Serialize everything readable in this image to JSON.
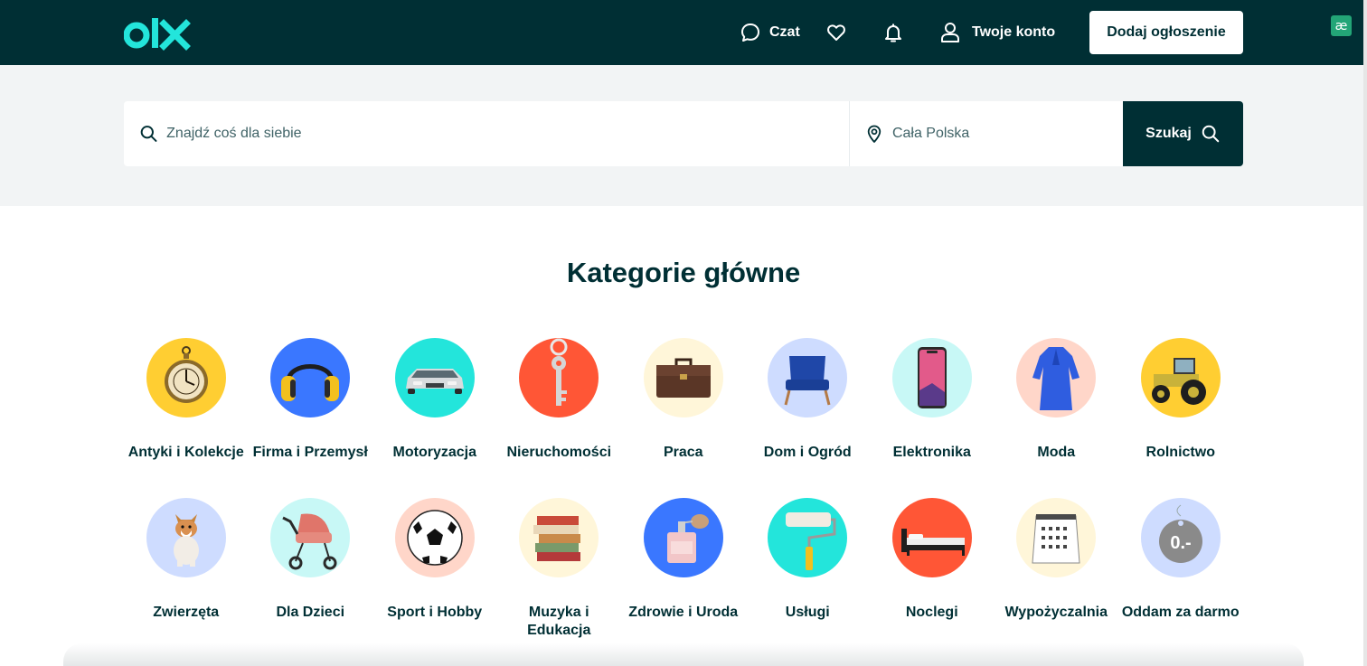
{
  "header": {
    "logo_text": "olx",
    "chat_label": "Czat",
    "account_label": "Twoje konto",
    "post_ad_label": "Dodaj ogłoszenie",
    "extension_badge": "æ",
    "colors": {
      "background": "#002f34",
      "logo": "#23e5db"
    }
  },
  "search": {
    "query_placeholder": "Znajdź coś dla siebie",
    "query_value": "",
    "location_placeholder": "Cała Polska",
    "location_value": "",
    "button_label": "Szukaj"
  },
  "categories": {
    "title": "Kategorie główne",
    "items": [
      {
        "label": "Antyki i Kolekcje",
        "icon": "pocket-watch-icon",
        "color": "#ffce32"
      },
      {
        "label": "Firma i Przemysł",
        "icon": "ear-protectors-icon",
        "color": "#3a77ff"
      },
      {
        "label": "Motoryzacja",
        "icon": "car-icon",
        "color": "#23e5db"
      },
      {
        "label": "Nieruchomości",
        "icon": "key-icon",
        "color": "#ff5636"
      },
      {
        "label": "Praca",
        "icon": "briefcase-icon",
        "color": "#fff6d9"
      },
      {
        "label": "Dom i Ogród",
        "icon": "armchair-icon",
        "color": "#cedcff"
      },
      {
        "label": "Elektronika",
        "icon": "smartphone-icon",
        "color": "#c8f8f6"
      },
      {
        "label": "Moda",
        "icon": "dress-icon",
        "color": "#ffd6c9"
      },
      {
        "label": "Rolnictwo",
        "icon": "tractor-icon",
        "color": "#ffce32"
      },
      {
        "label": "Zwierzęta",
        "icon": "dog-icon",
        "color": "#cedcff"
      },
      {
        "label": "Dla Dzieci",
        "icon": "stroller-icon",
        "color": "#c8f8f6"
      },
      {
        "label": "Sport i Hobby",
        "icon": "football-icon",
        "color": "#ffd6c9"
      },
      {
        "label": "Muzyka i Edukacja",
        "icon": "books-icon",
        "color": "#fff6d9"
      },
      {
        "label": "Zdrowie i Uroda",
        "icon": "perfume-icon",
        "color": "#3a77ff"
      },
      {
        "label": "Usługi",
        "icon": "paint-roller-icon",
        "color": "#23e5db"
      },
      {
        "label": "Noclegi",
        "icon": "bed-icon",
        "color": "#ff5636"
      },
      {
        "label": "Wypożyczalnia",
        "icon": "calendar-icon",
        "color": "#fff6d9"
      },
      {
        "label": "Oddam za darmo",
        "icon": "price-tag-icon",
        "color": "#cedcff",
        "icon_text": "0.-"
      }
    ]
  }
}
